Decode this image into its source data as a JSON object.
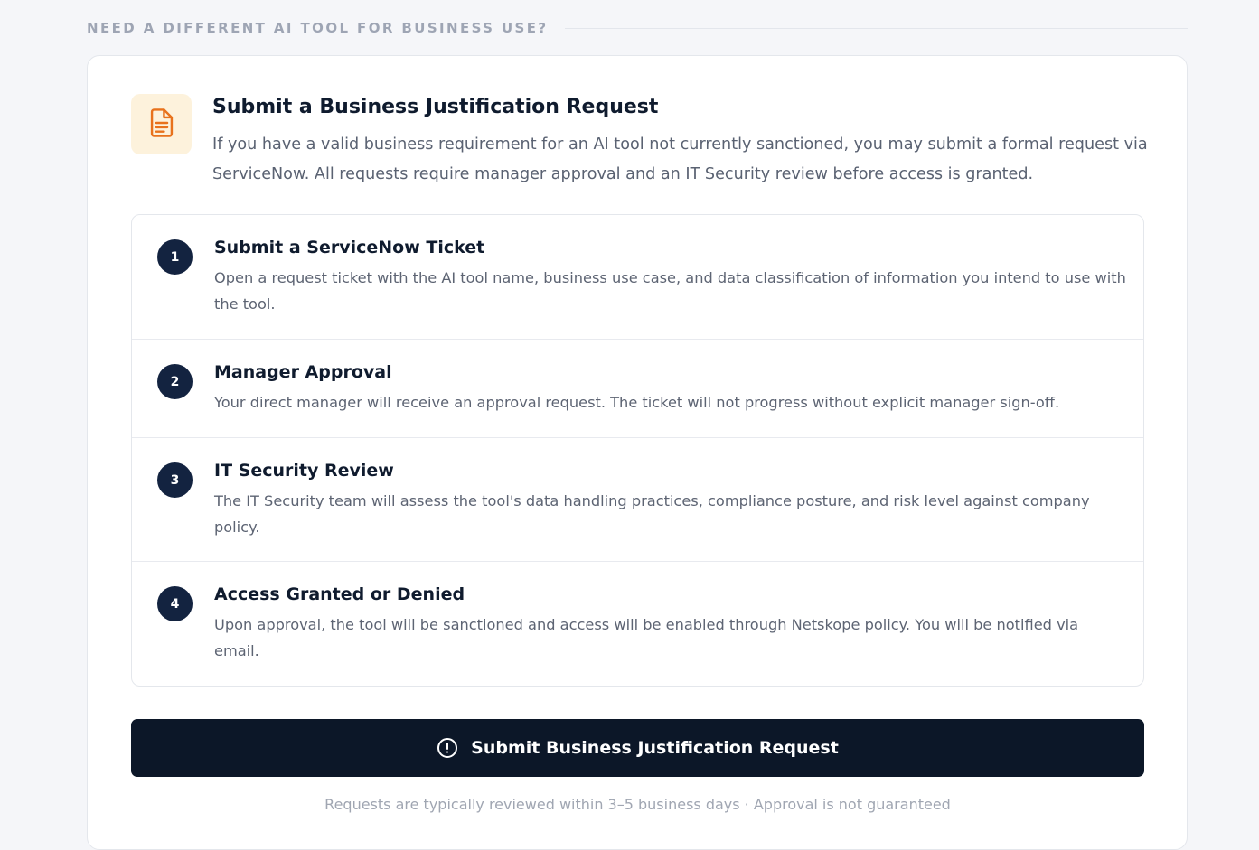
{
  "section": {
    "header": "NEED A DIFFERENT AI TOOL FOR BUSINESS USE?"
  },
  "intro": {
    "icon": "document-icon",
    "icon_color": "#e8721c",
    "icon_bg": "#fdf2dc",
    "title": "Submit a Business Justification Request",
    "text": "If you have a valid business requirement for an AI tool not currently sanctioned, you may submit a formal request via ServiceNow. All requests require manager approval and an IT Security review before access is granted."
  },
  "steps": [
    {
      "number": "1",
      "title": "Submit a ServiceNow Ticket",
      "description": "Open a request ticket with the AI tool name, business use case, and data classification of information you intend to use with the tool."
    },
    {
      "number": "2",
      "title": "Manager Approval",
      "description": "Your direct manager will receive an approval request. The ticket will not progress without explicit manager sign-off."
    },
    {
      "number": "3",
      "title": "IT Security Review",
      "description": "The IT Security team will assess the tool's data handling practices, compliance posture, and risk level against company policy."
    },
    {
      "number": "4",
      "title": "Access Granted or Denied",
      "description": "Upon approval, the tool will be sanctioned and access will be enabled through Netskope policy. You will be notified via email."
    }
  ],
  "submit": {
    "icon": "alert-circle-icon",
    "label": "Submit Business Justification Request",
    "bg_color": "#0c1728"
  },
  "footnote": "Requests are typically reviewed within 3–5 business days · Approval is not guaranteed"
}
